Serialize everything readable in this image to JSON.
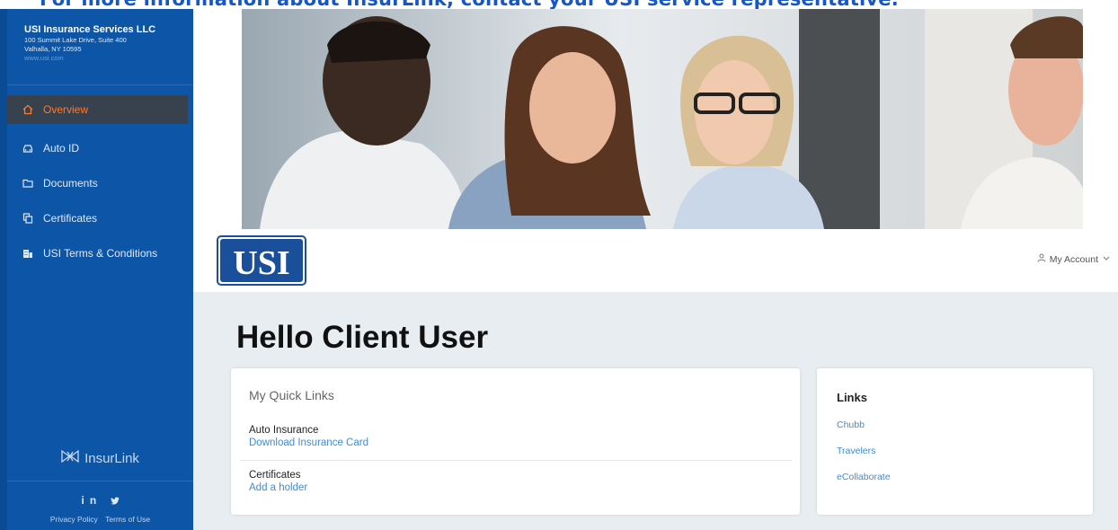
{
  "banner": {
    "text": "For more information about InsurLink, contact your USI service representative."
  },
  "sidebar": {
    "company_name": "USI Insurance Services LLC",
    "address_line1": "100 Summit Lake Drive, Suite 400",
    "address_line2": "Valhalla, NY 10595",
    "website": "www.usi.com",
    "items": [
      {
        "label": "Overview",
        "icon": "home-icon",
        "active": true
      },
      {
        "label": "Auto ID",
        "icon": "car-icon"
      },
      {
        "label": "Documents",
        "icon": "folder-icon"
      },
      {
        "label": "Certificates",
        "icon": "certificate-icon"
      },
      {
        "label": "USI Terms & Conditions",
        "icon": "building-icon"
      }
    ],
    "brand": "InsurLink",
    "social": "in ✕",
    "footer": {
      "privacy": "Privacy Policy",
      "terms": "Terms of Use"
    },
    "colors": {
      "background": "#0d55a6",
      "active_bg": "#38424f",
      "active_text": "#ff7a2e"
    }
  },
  "header": {
    "logo_text": "USI",
    "account_label": "My Account"
  },
  "main": {
    "greeting": "Hello Client User",
    "quick_links": {
      "title": "My Quick Links",
      "items": [
        {
          "label": "Auto Insurance",
          "link": "Download Insurance Card"
        },
        {
          "label": "Certificates",
          "link": "Add a holder"
        }
      ]
    },
    "links": {
      "title": "Links",
      "items": [
        "Chubb",
        "Travelers",
        "eCollaborate"
      ]
    }
  }
}
